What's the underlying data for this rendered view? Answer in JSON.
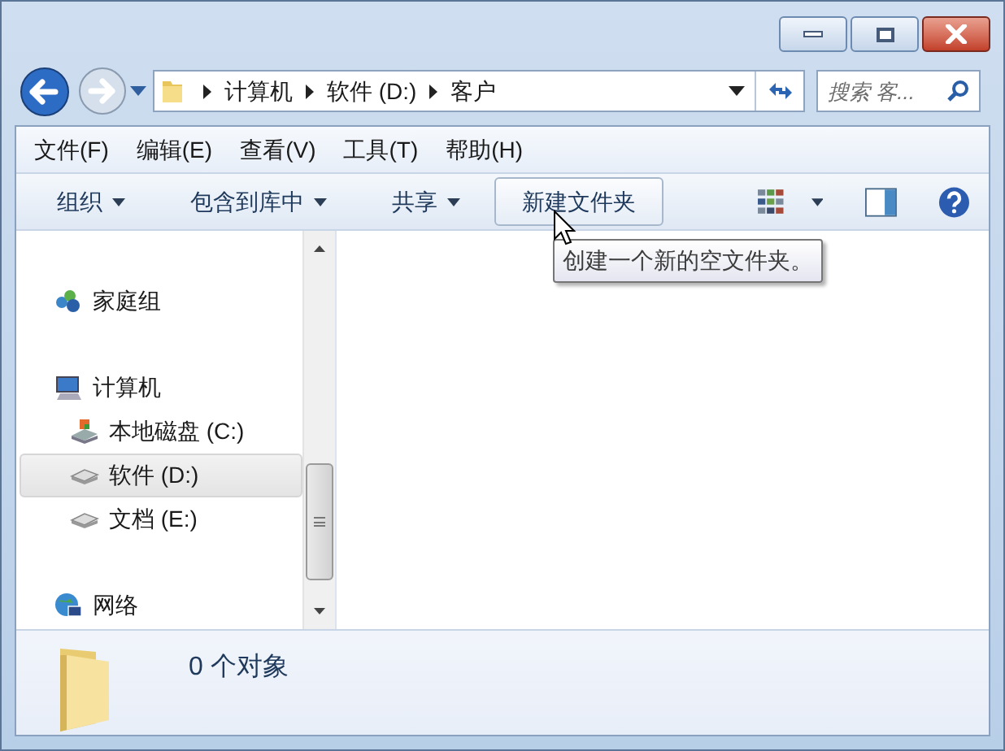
{
  "address": {
    "crumbs": [
      "计算机",
      "软件 (D:)",
      "客户"
    ]
  },
  "search": {
    "placeholder": "搜索 客..."
  },
  "menu": [
    "文件(F)",
    "编辑(E)",
    "查看(V)",
    "工具(T)",
    "帮助(H)"
  ],
  "toolbar": [
    {
      "label": "组织",
      "dropdown": true,
      "hovered": false
    },
    {
      "label": "包含到库中",
      "dropdown": true,
      "hovered": false
    },
    {
      "label": "共享",
      "dropdown": true,
      "hovered": false
    },
    {
      "label": "新建文件夹",
      "dropdown": false,
      "hovered": true
    }
  ],
  "tooltip": "创建一个新的空文件夹。",
  "nav": [
    {
      "label": "家庭组",
      "kind": "homegroup",
      "selected": false
    },
    {
      "label": "计算机",
      "kind": "computer",
      "selected": false,
      "children": [
        {
          "label": "本地磁盘 (C:)",
          "kind": "system-drive",
          "selected": false
        },
        {
          "label": "软件 (D:)",
          "kind": "drive",
          "selected": true
        },
        {
          "label": "文档 (E:)",
          "kind": "drive",
          "selected": false
        }
      ]
    },
    {
      "label": "网络",
      "kind": "network",
      "selected": false
    }
  ],
  "status": {
    "text": "0 个对象"
  }
}
